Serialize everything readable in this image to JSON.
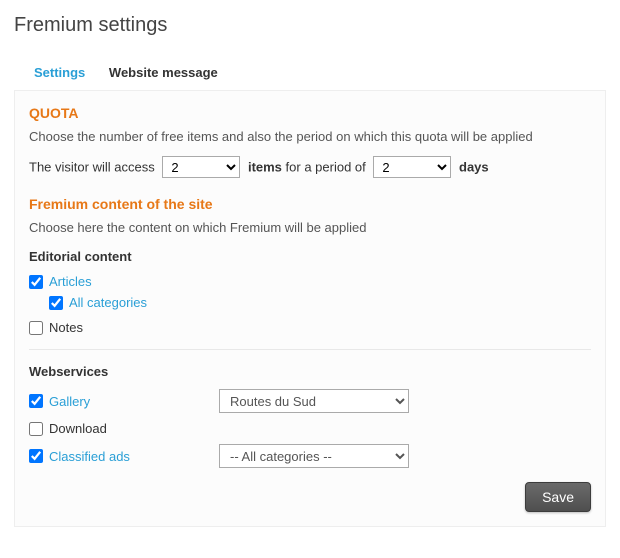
{
  "page": {
    "title": "Fremium settings"
  },
  "tabs": {
    "settings": "Settings",
    "website_message": "Website message"
  },
  "quota": {
    "heading": "QUOTA",
    "desc": "Choose the number of free items and also the period on which this quota will be applied",
    "prefix": "The visitor will access",
    "items_value": "2",
    "mid1": "items",
    "mid2": "for a period of",
    "period_value": "2",
    "suffix": "days"
  },
  "content": {
    "heading": "Fremium content of the site",
    "desc": "Choose here the content on which Fremium will be applied"
  },
  "editorial": {
    "heading": "Editorial content",
    "articles": {
      "label": "Articles",
      "checked": true
    },
    "all_categories": {
      "label": "All categories",
      "checked": true
    },
    "notes": {
      "label": "Notes",
      "checked": false
    }
  },
  "webservices": {
    "heading": "Webservices",
    "gallery": {
      "label": "Gallery",
      "checked": true,
      "select": "Routes du Sud"
    },
    "download": {
      "label": "Download",
      "checked": false
    },
    "classified": {
      "label": "Classified ads",
      "checked": true,
      "select": "-- All categories --"
    }
  },
  "footer": {
    "save": "Save"
  }
}
